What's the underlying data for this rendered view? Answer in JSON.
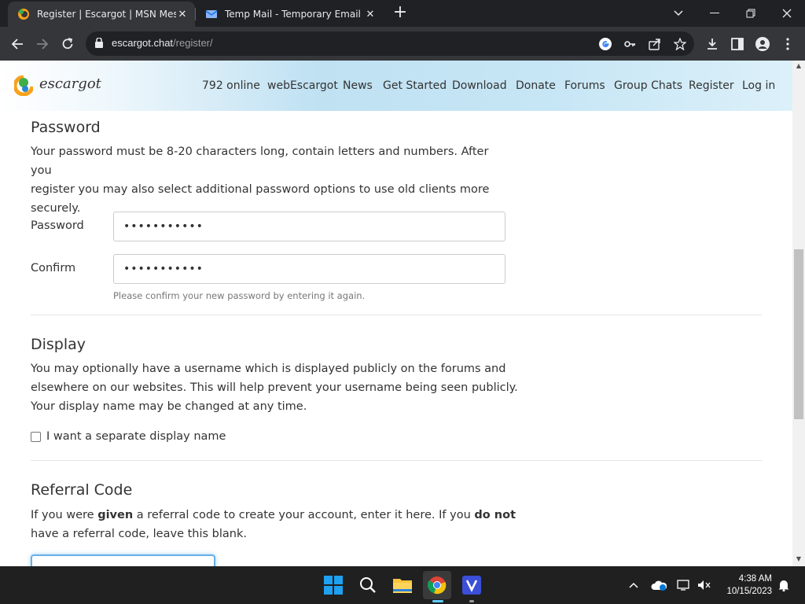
{
  "browser": {
    "tabs": [
      {
        "title": "Register | Escargot | MSN Messe",
        "active": true
      },
      {
        "title": "Temp Mail - Temporary Email",
        "active": false
      }
    ],
    "url_host": "escargot.chat",
    "url_path": "/register/"
  },
  "site": {
    "brand": "escargot",
    "nav": [
      "792 online",
      "webEscargot",
      "News",
      "Get Started",
      "Download",
      "Donate",
      "Forums",
      "Group Chats",
      "Register",
      "Log in"
    ]
  },
  "password_section": {
    "heading": "Password",
    "description_lines": [
      "Your password must be 8-20 characters long, contain letters and numbers. After you",
      "register you may also select additional password options to use old clients more",
      "securely."
    ],
    "password_label": "Password",
    "password_value": "•••••••••••",
    "confirm_label": "Confirm",
    "confirm_value": "•••••••••••",
    "confirm_help": "Please confirm your new password by entering it again."
  },
  "display_section": {
    "heading": "Display",
    "description_lines": [
      "You may optionally have a username which is displayed publicly on the forums and",
      "elsewhere on our websites. This will help prevent your username being seen publicly.",
      "Your display name may be changed at any time."
    ],
    "checkbox_label": "I want a separate display name",
    "checkbox_checked": false
  },
  "referral_section": {
    "heading": "Referral Code",
    "line1_a": "If you were ",
    "line1_b": "given",
    "line1_c": " a referral code to create your account, enter it here. If you ",
    "line1_d": "do not",
    "line2": "have a referral code, leave this blank.",
    "input_value": ""
  },
  "taskbar": {
    "time": "4:38 AM",
    "date": "10/15/2023"
  },
  "colors": {
    "chrome_dark": "#202124",
    "chrome_tab": "#35363a",
    "accent_blue": "#66afe9",
    "windows_blue": "#0078d4"
  }
}
